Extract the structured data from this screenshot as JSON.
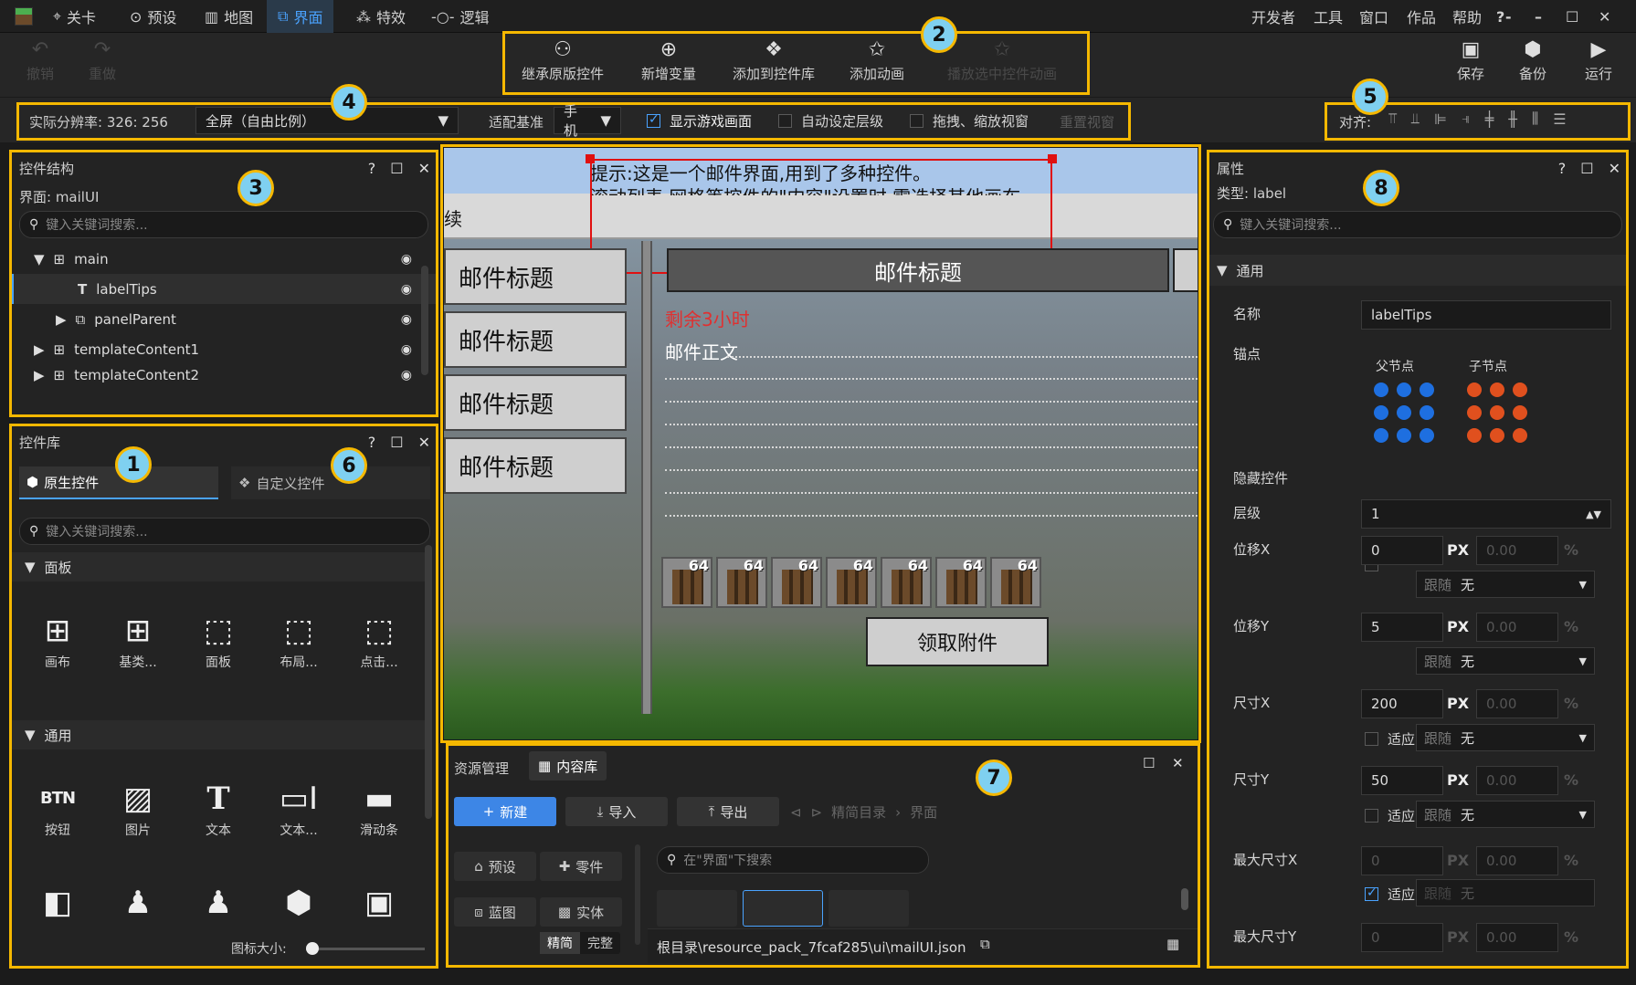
{
  "menubar": {
    "tabs": [
      {
        "label": "关卡",
        "icon": "level-icon"
      },
      {
        "label": "预设",
        "icon": "preset-icon"
      },
      {
        "label": "地图",
        "icon": "map-icon"
      },
      {
        "label": "界面",
        "icon": "ui-icon"
      },
      {
        "label": "特效",
        "icon": "effects-icon"
      },
      {
        "label": "逻辑",
        "icon": "logic-icon"
      }
    ],
    "right_menu": [
      "开发者",
      "工具",
      "窗口",
      "作品",
      "帮助"
    ]
  },
  "toolbar": {
    "undo": "撤销",
    "redo": "重做",
    "inherit": "继承原版控件",
    "new_var": "新增变量",
    "add_lib": "添加到控件库",
    "add_anim": "添加动画",
    "play_anim": "播放选中控件动画",
    "save": "保存",
    "backup": "备份",
    "run": "运行"
  },
  "optbar": {
    "resolution": "实际分辨率: 326: 256",
    "screen_mode": "全屏（自由比例）",
    "adapt_label": "适配基准",
    "adapt_value": "手机",
    "show_game": "显示游戏画面",
    "auto_layer": "自动设定层级",
    "drag_zoom": "拖拽、缩放视窗",
    "reset_view": "重置视窗",
    "align_label": "对齐:"
  },
  "callouts": [
    "1",
    "2",
    "3",
    "4",
    "5",
    "6",
    "7",
    "8"
  ],
  "structure": {
    "title": "控件结构",
    "ui_name": "界面: mailUI",
    "search_placeholder": "键入关键词搜索...",
    "nodes": [
      {
        "label": "main",
        "icon": "canvas-icon"
      },
      {
        "label": "labelTips",
        "icon": "text-icon"
      },
      {
        "label": "panelParent",
        "icon": "panel-icon"
      },
      {
        "label": "templateContent1",
        "icon": "canvas-icon"
      },
      {
        "label": "templateContent2",
        "icon": "canvas-icon"
      }
    ]
  },
  "library": {
    "title": "控件库",
    "tab_native": "原生控件",
    "tab_custom": "自定义控件",
    "search_placeholder": "键入关键词搜索...",
    "section_panel": "面板",
    "panel_items": [
      "画布",
      "基类...",
      "面板",
      "布局...",
      "点击..."
    ],
    "section_common": "通用",
    "common_items": [
      "按钮",
      "图片",
      "文本",
      "文本...",
      "滑动条"
    ],
    "icon_size_label": "图标大小:"
  },
  "game": {
    "tip_line1": "提示:这是一个邮件界面,用到了多种控件。",
    "tip_line2": "滚动列表,网格等控件的\"内容\"设置时,需选择其他画布",
    "tip_fragment": "续",
    "mail_titles": [
      "邮件标题",
      "邮件标题",
      "邮件标题",
      "邮件标题"
    ],
    "header_title": "邮件标题",
    "remaining": "剩余3小时",
    "body": "邮件正文",
    "slot_count": "64",
    "claim": "领取附件"
  },
  "resources": {
    "tab_manage": "资源管理",
    "tab_content": "内容库",
    "new": "新建",
    "import": "导入",
    "export": "导出",
    "crumb_root": "精简目录",
    "crumb_ui": "界面",
    "cat_preset": "预设",
    "cat_part": "零件",
    "cat_blueprint": "蓝图",
    "cat_entity": "实体",
    "mode_simple": "精简",
    "mode_full": "完整",
    "search_placeholder": "在\"界面\"下搜索",
    "path": "根目录\\resource_pack_7fcaf285\\ui\\mailUI.json"
  },
  "props": {
    "title": "属性",
    "type": "类型:  label",
    "search_placeholder": "键入关键词搜索...",
    "section": "通用",
    "name_label": "名称",
    "name_value": "labelTips",
    "anchor_label": "锚点",
    "parent_anchor": "父节点",
    "child_anchor": "子节点",
    "hide_label": "隐藏控件",
    "layer_label": "层级",
    "layer_value": "1",
    "posx_label": "位移X",
    "posx_value": "0",
    "posy_label": "位移Y",
    "posy_value": "5",
    "sizex_label": "尺寸X",
    "sizex_value": "200",
    "sizey_label": "尺寸Y",
    "sizey_value": "50",
    "maxx_label": "最大尺寸X",
    "maxx_value": "0",
    "maxy_label": "最大尺寸Y",
    "maxy_value": "0",
    "pct_value": "0.00",
    "unit_px": "PX",
    "unit_pct": "%",
    "follow_label": "跟随",
    "follow_value": "无",
    "fit_label": "适应"
  },
  "colors": {
    "accent": "#4aa3ff",
    "highlight": "#f5b800",
    "callout": "#7fd0f0",
    "selection": "#e01010",
    "remaining_text": "#e03030",
    "anchor_parent": "#1e6fe0",
    "anchor_child": "#e0501e"
  }
}
